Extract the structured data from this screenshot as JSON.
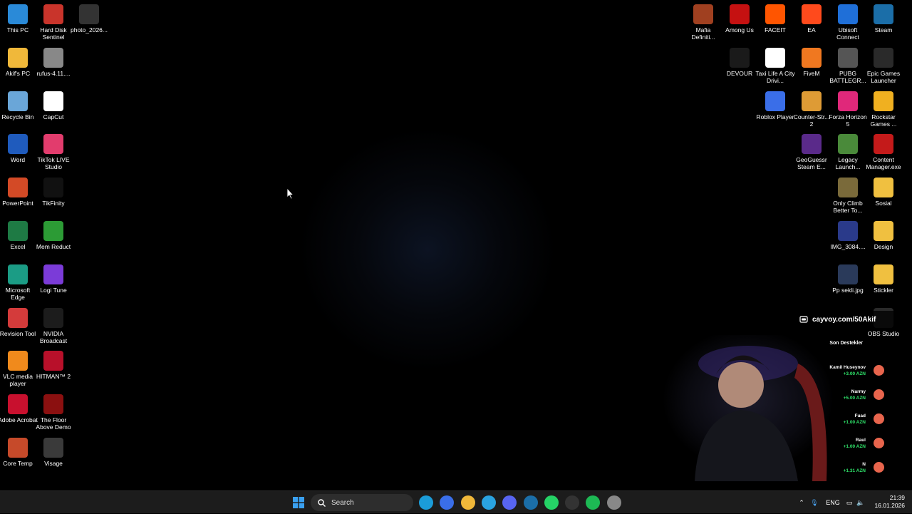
{
  "desktop": {
    "left_col1": [
      {
        "label": "This PC",
        "icon": "this-pc-icon",
        "color": "#2a8ad8"
      },
      {
        "label": "Akif's PC",
        "icon": "folder-icon",
        "color": "#f0b83a"
      },
      {
        "label": "Recycle Bin",
        "icon": "recycle-bin-icon",
        "color": "#6aa6d8"
      },
      {
        "label": "Word",
        "icon": "word-icon",
        "color": "#1f5bbd"
      },
      {
        "label": "PowerPoint",
        "icon": "powerpoint-icon",
        "color": "#d34a26"
      },
      {
        "label": "Excel",
        "icon": "excel-icon",
        "color": "#1e7a44"
      },
      {
        "label": "Microsoft Edge",
        "icon": "edge-icon",
        "color": "#1b9c85"
      },
      {
        "label": "Revision Tool",
        "icon": "revision-tool-icon",
        "color": "#d43b3b"
      },
      {
        "label": "VLC media player",
        "icon": "vlc-icon",
        "color": "#f08a1c"
      },
      {
        "label": "Adobe Acrobat",
        "icon": "acrobat-icon",
        "color": "#c8102e"
      },
      {
        "label": "Core Temp",
        "icon": "core-temp-icon",
        "color": "#c64a2a"
      }
    ],
    "left_col2": [
      {
        "label": "Hard Disk Sentinel",
        "icon": "hard-disk-sentinel-icon",
        "color": "#c9342b"
      },
      {
        "label": "rufus-4.11....",
        "icon": "rufus-icon",
        "color": "#888888"
      },
      {
        "label": "CapCut",
        "icon": "capcut-icon",
        "color": "#ffffff"
      },
      {
        "label": "TikTok LIVE Studio",
        "icon": "tiktok-live-icon",
        "color": "#e23c6d"
      },
      {
        "label": "TikFinity",
        "icon": "tikfinity-icon",
        "color": "#111111"
      },
      {
        "label": "Mem Reduct",
        "icon": "mem-reduct-icon",
        "color": "#2c9b35"
      },
      {
        "label": "Logi Tune",
        "icon": "logi-tune-icon",
        "color": "#7b3bd8"
      },
      {
        "label": "NVIDIA Broadcast",
        "icon": "nvidia-broadcast-icon",
        "color": "#1c1c1c"
      },
      {
        "label": "HITMAN™ 2",
        "icon": "hitman-icon",
        "color": "#b8102a"
      },
      {
        "label": "The Floor Above Demo",
        "icon": "floor-above-icon",
        "color": "#8b1010"
      },
      {
        "label": "Visage",
        "icon": "visage-icon",
        "color": "#3a3a3a"
      }
    ],
    "left_col3": [
      {
        "label": "photo_2026...",
        "icon": "photo-file-icon",
        "color": "#333333"
      }
    ],
    "right_col1": [
      {
        "label": "Mafia Definiti...",
        "icon": "mafia-icon",
        "color": "#a04020"
      }
    ],
    "right_col2": [
      {
        "label": "Among Us",
        "icon": "among-us-icon",
        "color": "#c51111"
      },
      {
        "label": "DEVOUR",
        "icon": "devour-icon",
        "color": "#1a1a1a"
      }
    ],
    "right_col3": [
      {
        "label": "FACEIT",
        "icon": "faceit-icon",
        "color": "#ff5500"
      },
      {
        "label": "Taxi Life A City Drivi...",
        "icon": "taxi-life-icon",
        "color": "#ffffff"
      },
      {
        "label": "Roblox Player",
        "icon": "roblox-icon",
        "color": "#3a6ee8"
      }
    ],
    "right_col4": [
      {
        "label": "EA",
        "icon": "ea-icon",
        "color": "#ff4a1c"
      },
      {
        "label": "FiveM",
        "icon": "fivem-icon",
        "color": "#f07820"
      },
      {
        "label": "Counter-Str... 2",
        "icon": "cs2-icon",
        "color": "#de9b35"
      },
      {
        "label": "GeoGuessr Steam E...",
        "icon": "geoguessr-icon",
        "color": "#5a2a8a"
      }
    ],
    "right_col5": [
      {
        "label": "Ubisoft Connect",
        "icon": "ubisoft-icon",
        "color": "#1f6fd8"
      },
      {
        "label": "PUBG BATTLEGR...",
        "icon": "pubg-icon",
        "color": "#555555"
      },
      {
        "label": "Forza Horizon 5",
        "icon": "forza-icon",
        "color": "#e0287a"
      },
      {
        "label": "Legacy Launch...",
        "icon": "legacy-launcher-icon",
        "color": "#4a8a3a"
      },
      {
        "label": "Only Climb Better To...",
        "icon": "only-climb-icon",
        "color": "#7a6a3a"
      },
      {
        "label": "IMG_3084....",
        "icon": "image-file-icon",
        "color": "#2a3a8a"
      },
      {
        "label": "Pp sekli.jpg",
        "icon": "image-file-icon",
        "color": "#2a3a5a"
      }
    ],
    "right_col6": [
      {
        "label": "Steam",
        "icon": "steam-icon",
        "color": "#1b6ea8"
      },
      {
        "label": "Epic Games Launcher",
        "icon": "epic-games-icon",
        "color": "#2a2a2a"
      },
      {
        "label": "Rockstar Games ...",
        "icon": "rockstar-icon",
        "color": "#f0b020"
      },
      {
        "label": "Content Manager.exe",
        "icon": "content-manager-icon",
        "color": "#c41a1a"
      },
      {
        "label": "Sosial",
        "icon": "folder-icon",
        "color": "#f0c040"
      },
      {
        "label": "Design",
        "icon": "folder-icon",
        "color": "#f0c040"
      },
      {
        "label": "Stickler",
        "icon": "folder-icon",
        "color": "#f0c040"
      },
      {
        "label": "OBS Studio",
        "icon": "obs-icon",
        "color": "#2a2a2a"
      }
    ]
  },
  "overlay": {
    "donate_link": "cayvoy.com/50Akif",
    "supporters_title": "Son Destekler",
    "supporters": [
      {
        "name": "Kamil Huseynov",
        "amount": "+3.00 AZN"
      },
      {
        "name": "Narmy",
        "amount": "+5.00 AZN"
      },
      {
        "name": "Fuad",
        "amount": "+1.00 AZN"
      },
      {
        "name": "Raul",
        "amount": "+1.00 AZN"
      },
      {
        "name": "N",
        "amount": "+1.31 AZN"
      }
    ]
  },
  "taskbar": {
    "search_placeholder": "Search",
    "apps": [
      {
        "name": "edge-taskbar-icon",
        "color": "#1b9cd8"
      },
      {
        "name": "store-taskbar-icon",
        "color": "#3a6ee8"
      },
      {
        "name": "file-explorer-taskbar-icon",
        "color": "#f0b83a"
      },
      {
        "name": "telegram-taskbar-icon",
        "color": "#2aa3e0"
      },
      {
        "name": "discord-taskbar-icon",
        "color": "#5865f2"
      },
      {
        "name": "steam-taskbar-icon",
        "color": "#1b6ea8"
      },
      {
        "name": "whatsapp-taskbar-icon",
        "color": "#25d366"
      },
      {
        "name": "epic-taskbar-icon",
        "color": "#333333"
      },
      {
        "name": "spotify-taskbar-icon",
        "color": "#1db954"
      },
      {
        "name": "chrome-taskbar-icon",
        "color": "#888888"
      }
    ],
    "language": "ENG",
    "time": "21:39",
    "date": "16.01.2026"
  }
}
